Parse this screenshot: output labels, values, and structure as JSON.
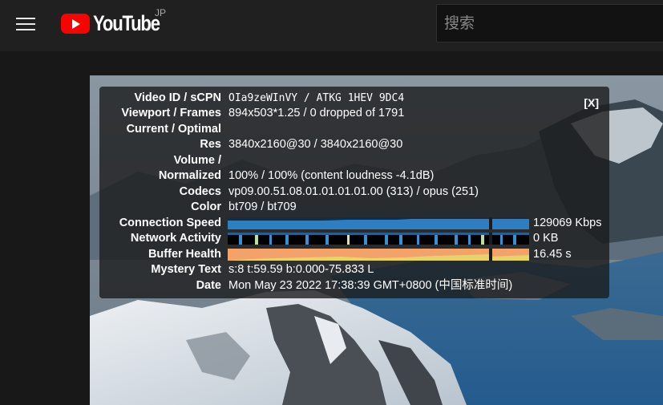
{
  "masthead": {
    "logo_text": "YouTube",
    "country_code": "JP",
    "search_placeholder": "搜索"
  },
  "stats": {
    "close_label": "[X]",
    "rows": [
      {
        "label": "Video ID / sCPN",
        "value": "OIa9zeWInVY / ATKG 1HEV 9DC4"
      },
      {
        "label": "Viewport / Frames",
        "value": "894x503*1.25 / 0 dropped of 1791"
      },
      {
        "label": "Current / Optimal",
        "value": ""
      },
      {
        "label": "Res",
        "value": "3840x2160@30 / 3840x2160@30"
      },
      {
        "label": "Volume /",
        "value": ""
      },
      {
        "label": "Normalized",
        "value": "100% / 100% (content loudness -4.1dB)"
      },
      {
        "label": "Codecs",
        "value": "vp09.00.51.08.01.01.01.01.00 (313) / opus (251)"
      },
      {
        "label": "Color",
        "value": "bt709 / bt709"
      },
      {
        "label": "Connection Speed",
        "value": "129069 Kbps"
      },
      {
        "label": "Network Activity",
        "value": "0 KB"
      },
      {
        "label": "Buffer Health",
        "value": "16.45 s"
      },
      {
        "label": "Mystery Text",
        "value": "s:8 t:59.59 b:0.000-75.833 L"
      },
      {
        "label": "Date",
        "value": "Mon May 23 2022 17:38:39 GMT+0800 (中国标准时间)"
      }
    ]
  },
  "colors": {
    "connection_graph": "#2d7fc2",
    "network_graph_bg": "#000000",
    "buffer_graph": "#f3a36a",
    "buffer_graph_accent": "#e6d46a",
    "brand_red": "#ff0000"
  }
}
